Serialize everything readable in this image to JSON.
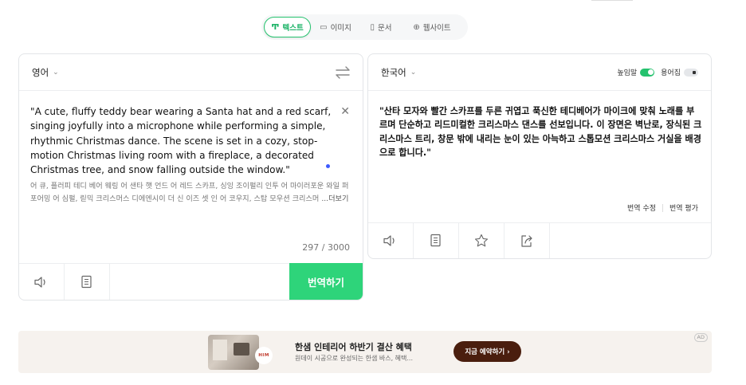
{
  "mode_tabs": [
    {
      "label": "텍스트",
      "icon": "text-icon",
      "glyph": "Ͳ"
    },
    {
      "label": "이미지",
      "icon": "image-icon",
      "glyph": "▭"
    },
    {
      "label": "문서",
      "icon": "document-icon",
      "glyph": "▯"
    },
    {
      "label": "웹사이트",
      "icon": "globe-icon",
      "glyph": "⊕"
    }
  ],
  "source": {
    "language": "영어",
    "text": "\"A cute, fluffy teddy bear wearing a Santa hat and a red scarf, singing joyfully into a microphone while performing a simple, rhythmic Christmas dance. The scene is set in a cozy, stop-motion Christmas living room with a fireplace, a decorated Christmas tree, and snow falling outside the window.\"",
    "pronunciation": "어 큐, 플러피 테디 베어 웨링 어 샌타 햇 언드 어 레드 스카프, 싱잉 조이펄리 인투 어 마이러포운 와일 퍼포어밍 어 심펄, 릳믹 크리스머스 디에엔시이 더 신 이즈 셋 인 어 코우지, 스탑 모우션 크리스머 ",
    "more": "...더보기",
    "char_count": "297 / 3000",
    "translate_button": "번역하기"
  },
  "target": {
    "language": "한국어",
    "toggle_honorific": "높임말",
    "toggle_glossary": "용어집",
    "text": "\"산타 모자와 빨간 스카프를 두른 귀엽고 푹신한 테디베어가 마이크에 맞춰 노래를 부르며 단순하고 리드미컬한 크리스마스 댄스를 선보입니다. 이 장면은 벽난로, 장식된 크리스마스 트리, 창문 밖에 내리는 눈이 있는 아늑하고 스톱모션 크리스마스 거실을 배경으로 합니다.\"",
    "edit_translation": "번역 수정",
    "rate_translation": "번역 평가"
  },
  "ad": {
    "badge": "AD",
    "logo_text": "HIM",
    "title": "한샘 인테리어 하반기 결산 혜택",
    "subtitle": "원데이 시공으로 완성되는 한샘 바스, 혜택...",
    "cta": "지금 예약하기 ›"
  },
  "colors": {
    "accent": "#2ed47a",
    "toggle_on": "#25c26e",
    "ad_button": "#4a1e0e"
  }
}
